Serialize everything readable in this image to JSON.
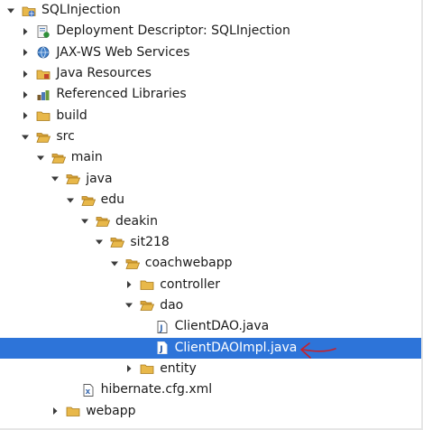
{
  "tree": {
    "rows": [
      {
        "label": "SQLInjection",
        "depth": 0,
        "twisty": "expanded",
        "icon": "project-icon"
      },
      {
        "label": "Deployment Descriptor: SQLInjection",
        "depth": 1,
        "twisty": "collapsed",
        "icon": "deployment-descriptor-icon"
      },
      {
        "label": "JAX-WS Web Services",
        "depth": 1,
        "twisty": "collapsed",
        "icon": "web-services-icon"
      },
      {
        "label": "Java Resources",
        "depth": 1,
        "twisty": "collapsed",
        "icon": "java-resources-icon"
      },
      {
        "label": "Referenced Libraries",
        "depth": 1,
        "twisty": "collapsed",
        "icon": "library-icon"
      },
      {
        "label": "build",
        "depth": 1,
        "twisty": "collapsed",
        "icon": "folder-icon"
      },
      {
        "label": "src",
        "depth": 1,
        "twisty": "expanded",
        "icon": "folder-open-icon"
      },
      {
        "label": "main",
        "depth": 2,
        "twisty": "expanded",
        "icon": "folder-open-icon"
      },
      {
        "label": "java",
        "depth": 3,
        "twisty": "expanded",
        "icon": "folder-open-icon"
      },
      {
        "label": "edu",
        "depth": 4,
        "twisty": "expanded",
        "icon": "folder-open-icon"
      },
      {
        "label": "deakin",
        "depth": 5,
        "twisty": "expanded",
        "icon": "folder-open-icon"
      },
      {
        "label": "sit218",
        "depth": 6,
        "twisty": "expanded",
        "icon": "folder-open-icon"
      },
      {
        "label": "coachwebapp",
        "depth": 7,
        "twisty": "expanded",
        "icon": "folder-open-icon"
      },
      {
        "label": "controller",
        "depth": 8,
        "twisty": "collapsed",
        "icon": "folder-icon"
      },
      {
        "label": "dao",
        "depth": 8,
        "twisty": "expanded",
        "icon": "folder-open-icon"
      },
      {
        "label": "ClientDAO.java",
        "depth": 9,
        "twisty": "none",
        "icon": "java-file-icon"
      },
      {
        "label": "ClientDAOImpl.java",
        "depth": 9,
        "twisty": "none",
        "icon": "java-file-icon",
        "selected": true
      },
      {
        "label": "entity",
        "depth": 8,
        "twisty": "collapsed",
        "icon": "folder-icon"
      },
      {
        "label": "hibernate.cfg.xml",
        "depth": 4,
        "twisty": "none",
        "icon": "xml-file-icon"
      },
      {
        "label": "webapp",
        "depth": 3,
        "twisty": "collapsed",
        "icon": "folder-icon"
      }
    ]
  },
  "colors": {
    "selection": "#2d74d9",
    "folder": "#e8b84a",
    "annotation": "#c8202a"
  }
}
